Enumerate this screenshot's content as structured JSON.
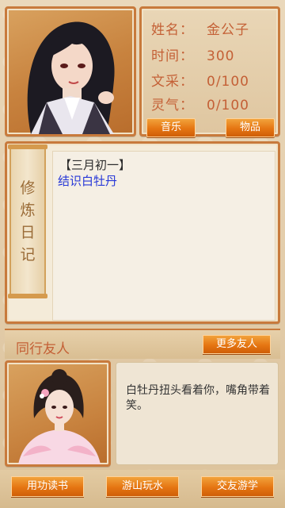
{
  "profile": {
    "name_label": "姓名：",
    "name_value": "金公子",
    "time_label": "时间：",
    "time_value": "300",
    "literary_label": "文采：",
    "literary_value": "0/100",
    "spirit_label": "灵气：",
    "spirit_value": "0/100",
    "music_button": "音乐",
    "items_button": "物品"
  },
  "diary": {
    "tab_chars": [
      "修",
      "炼",
      "日",
      "记"
    ],
    "date": "【三月初一】",
    "entry": "结识白牡丹"
  },
  "companions": {
    "title": "同行友人",
    "more_button": "更多友人",
    "speech": "白牡丹扭头看着你，嘴角带着笑。"
  },
  "actions": {
    "study": "用功读书",
    "travel": "游山玩水",
    "friends": "交友游学"
  },
  "colors": {
    "accent_orange": "#e57512",
    "label_red": "#c46036",
    "entry_blue": "#2738d8"
  }
}
